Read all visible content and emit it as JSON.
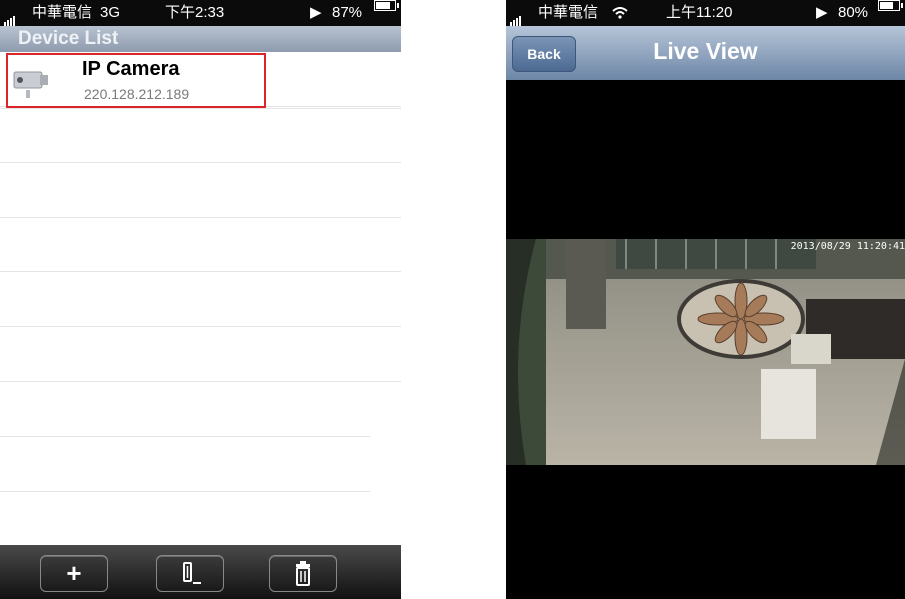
{
  "left": {
    "status": {
      "carrier": "中華電信",
      "network": "3G",
      "time": "下午2:33",
      "battery": "87%",
      "battery_level": 0.87
    },
    "header_title": "Device List",
    "device": {
      "name": "IP Camera",
      "ip": "220.128.212.189"
    },
    "toolbar": {
      "add_label": "+",
      "edit_icon": "edit-icon",
      "delete_icon": "trash-icon"
    }
  },
  "right": {
    "status": {
      "carrier": "中華電信",
      "time": "上午11:20",
      "battery": "80%",
      "battery_level": 0.8
    },
    "back_label": "Back",
    "title": "Live View",
    "timestamp": "2013/08/29 11:20:41"
  },
  "colors": {
    "highlight": "#d9262b",
    "nav_blue": "#6d86a6"
  }
}
